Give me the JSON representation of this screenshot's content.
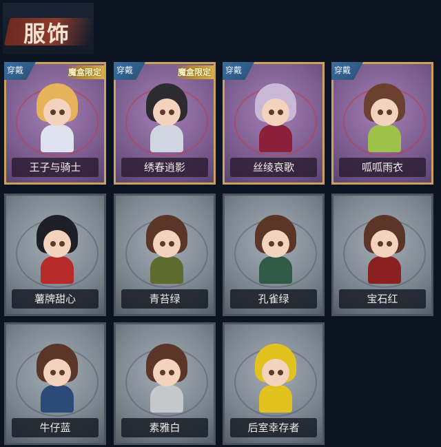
{
  "header": {
    "title": "服饰"
  },
  "badges": {
    "wear": "穿戴",
    "limited": "魔盒限定"
  },
  "cards": [
    {
      "name": "王子与骑士",
      "style": "purple",
      "wear": true,
      "limited": true,
      "hair": "#e6b25a",
      "body": "#dfe3f0"
    },
    {
      "name": "绣春逍影",
      "style": "purple",
      "wear": true,
      "limited": true,
      "hair": "#2b2b30",
      "body": "#cfd6e0"
    },
    {
      "name": "丝绫哀歌",
      "style": "purple",
      "wear": true,
      "limited": false,
      "hair": "#c9b8d6",
      "body": "#8c1f3a"
    },
    {
      "name": "呱呱雨衣",
      "style": "purple",
      "wear": true,
      "limited": false,
      "hair": "#6b4030",
      "body": "#9ec24a"
    },
    {
      "name": "薯牌甜心",
      "style": "gray",
      "wear": false,
      "limited": false,
      "hair": "#1e1e26",
      "body": "#b72a2a"
    },
    {
      "name": "青苔绿",
      "style": "gray",
      "wear": false,
      "limited": false,
      "hair": "#5a3528",
      "body": "#5e6a2e"
    },
    {
      "name": "孔雀绿",
      "style": "gray",
      "wear": false,
      "limited": false,
      "hair": "#5a3528",
      "body": "#2e5a46"
    },
    {
      "name": "宝石红",
      "style": "gray",
      "wear": false,
      "limited": false,
      "hair": "#5a3528",
      "body": "#8a2020"
    },
    {
      "name": "牛仔蓝",
      "style": "gray",
      "wear": false,
      "limited": false,
      "hair": "#5a3528",
      "body": "#2a4a78"
    },
    {
      "name": "素雅白",
      "style": "gray",
      "wear": false,
      "limited": false,
      "hair": "#5a3528",
      "body": "#c6c9cc"
    },
    {
      "name": "后室幸存者",
      "style": "gray",
      "wear": false,
      "limited": false,
      "hair": "#e2c21e",
      "body": "#e2c21e"
    }
  ]
}
